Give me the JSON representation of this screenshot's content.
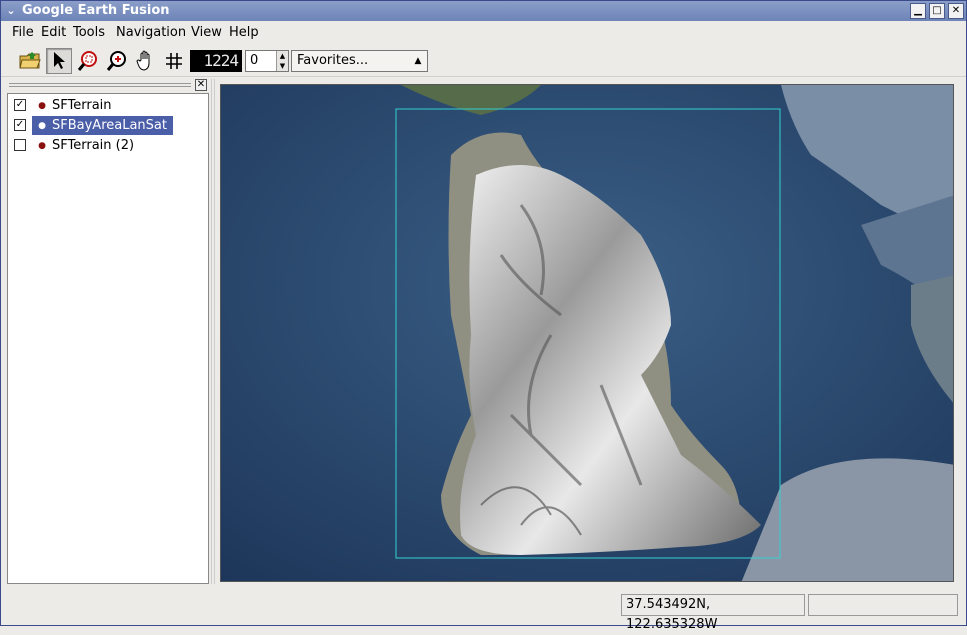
{
  "window": {
    "title": "Google Earth Fusion"
  },
  "menu": {
    "file": "File",
    "edit": "Edit",
    "tools": "Tools",
    "navigation": "Navigation",
    "view": "View",
    "help": "Help"
  },
  "toolbar": {
    "zoom_level": "1224",
    "spin_value": "0",
    "favorites": "Favorites..."
  },
  "layers": [
    {
      "label": "SFTerrain",
      "checked": true
    },
    {
      "label": "SFBayAreaLanSat",
      "checked": true
    },
    {
      "label": "SFTerrain (2)",
      "checked": false
    }
  ],
  "status": {
    "coordinates": "37.543492N, 122.635328W"
  },
  "colors": {
    "title_bar": "#6d84b8",
    "selection": "#4b5ea8",
    "bounding_box": "#34d0d0"
  }
}
